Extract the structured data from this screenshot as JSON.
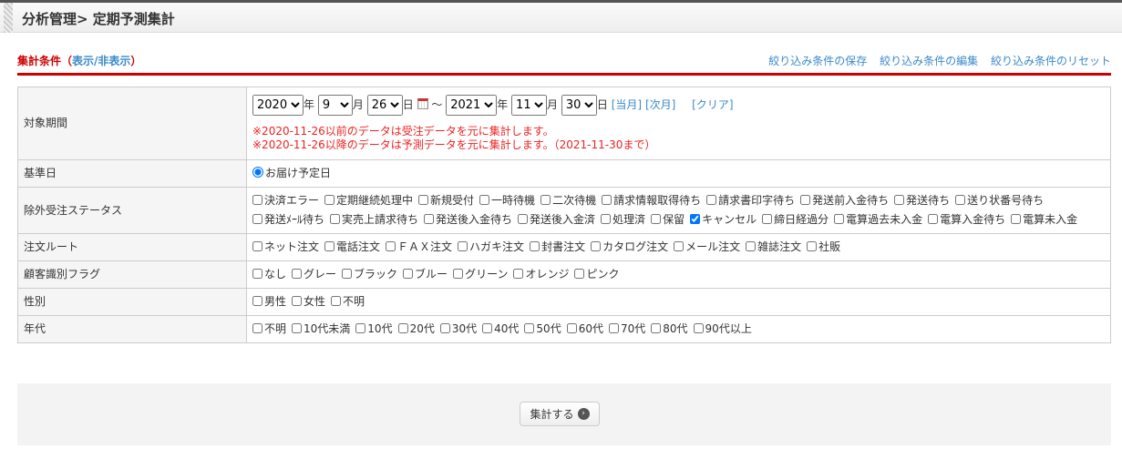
{
  "header": {
    "title": "分析管理> 定期予測集計"
  },
  "section": {
    "title": "集計条件",
    "toggle_open": "（",
    "toggle": "表示/非表示",
    "toggle_close": "）",
    "links": [
      "絞り込み条件の保存",
      "絞り込み条件の編集",
      "絞り込み条件のリセット"
    ]
  },
  "period": {
    "label": "対象期間",
    "from_year": "2020",
    "from_month": "9",
    "from_day": "26",
    "to_year": "2021",
    "to_month": "11",
    "to_day": "30",
    "year_unit": "年",
    "month_unit": "月",
    "day_unit": "日",
    "tilde": "～",
    "this_month": "[当月]",
    "next_month": "[次月]",
    "clear": "[クリア]",
    "note1": "※2020-11-26以前のデータは受注データを元に集計します。",
    "note2": "※2020-11-26以降のデータは予測データを元に集計します。（2021-11-30まで）"
  },
  "base_date": {
    "label": "基準日",
    "option": "お届け予定日"
  },
  "rows": [
    {
      "label": "除外受注ステータス",
      "items": [
        {
          "t": "決済エラー"
        },
        {
          "t": "定期継続処理中"
        },
        {
          "t": "新規受付"
        },
        {
          "t": "一時待機"
        },
        {
          "t": "二次待機"
        },
        {
          "t": "請求情報取得待ち"
        },
        {
          "t": "請求書印字待ち"
        },
        {
          "t": "発送前入金待ち"
        },
        {
          "t": "発送待ち"
        },
        {
          "t": "送り状番号待ち"
        },
        {
          "t": "発送ﾒｰﾙ待ち"
        },
        {
          "t": "実売上請求待ち"
        },
        {
          "t": "発送後入金待ち"
        },
        {
          "t": "発送後入金済"
        },
        {
          "t": "処理済"
        },
        {
          "t": "保留"
        },
        {
          "t": "キャンセル",
          "c": true
        },
        {
          "t": "締日経過分"
        },
        {
          "t": "電算過去未入金"
        },
        {
          "t": "電算入金待ち"
        },
        {
          "t": "電算未入金"
        }
      ]
    },
    {
      "label": "注文ルート",
      "items": [
        {
          "t": "ネット注文"
        },
        {
          "t": "電話注文"
        },
        {
          "t": "ＦＡＸ注文"
        },
        {
          "t": "ハガキ注文"
        },
        {
          "t": "封書注文"
        },
        {
          "t": "カタログ注文"
        },
        {
          "t": "メール注文"
        },
        {
          "t": "雑誌注文"
        },
        {
          "t": "社販"
        }
      ]
    },
    {
      "label": "顧客識別フラグ",
      "items": [
        {
          "t": "なし"
        },
        {
          "t": "グレー"
        },
        {
          "t": "ブラック"
        },
        {
          "t": "ブルー"
        },
        {
          "t": "グリーン"
        },
        {
          "t": "オレンジ"
        },
        {
          "t": "ピンク"
        }
      ]
    },
    {
      "label": "性別",
      "items": [
        {
          "t": "男性"
        },
        {
          "t": "女性"
        },
        {
          "t": "不明"
        }
      ]
    },
    {
      "label": "年代",
      "items": [
        {
          "t": "不明"
        },
        {
          "t": "10代未満"
        },
        {
          "t": "10代"
        },
        {
          "t": "20代"
        },
        {
          "t": "30代"
        },
        {
          "t": "40代"
        },
        {
          "t": "50代"
        },
        {
          "t": "60代"
        },
        {
          "t": "70代"
        },
        {
          "t": "80代"
        },
        {
          "t": "90代以上"
        }
      ]
    }
  ],
  "submit": {
    "label": "集計する"
  }
}
